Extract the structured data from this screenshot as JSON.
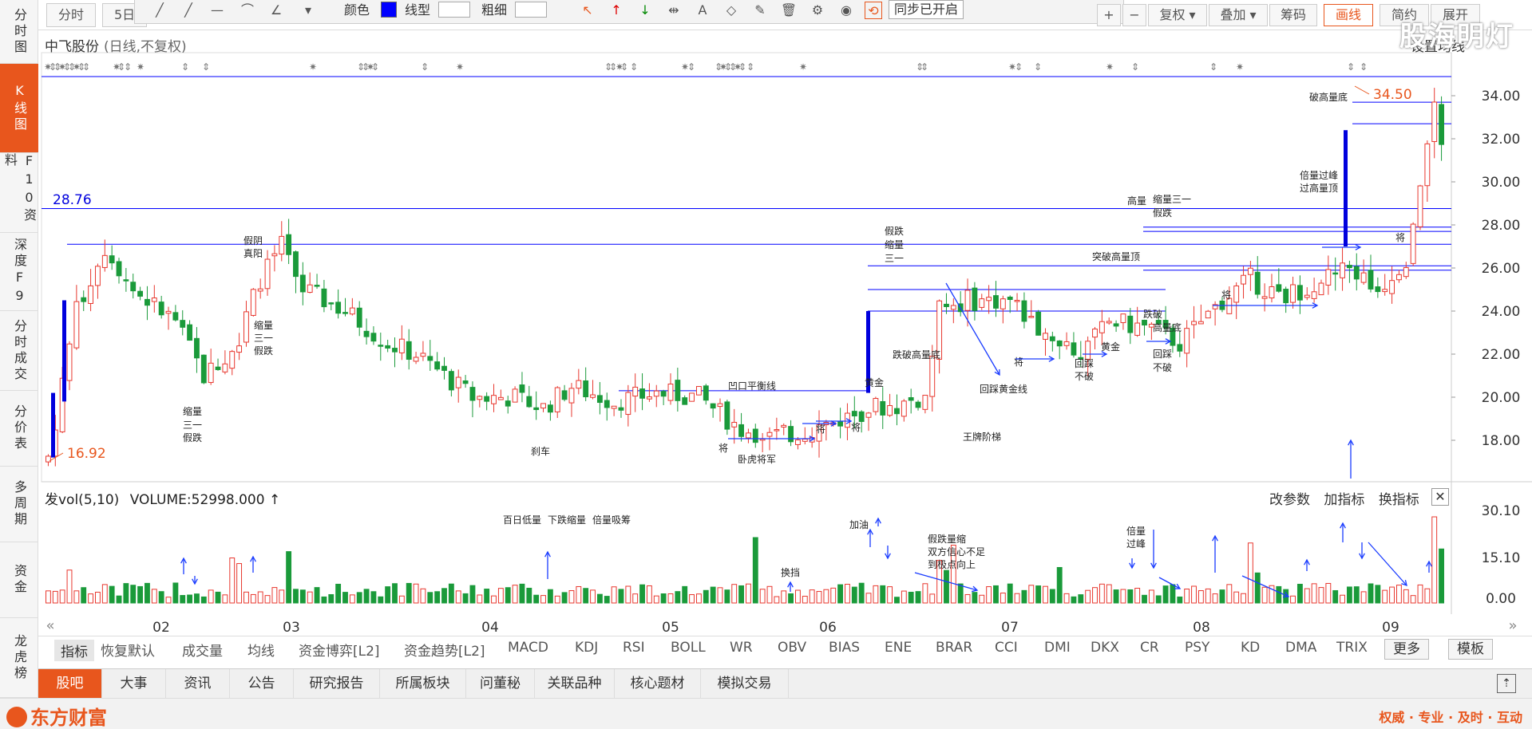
{
  "sidebar": {
    "items": [
      {
        "label": "分时图"
      },
      {
        "label": "K线图"
      },
      {
        "label": "F10资料"
      },
      {
        "label": "深度F9"
      },
      {
        "label": "分时成交"
      },
      {
        "label": "分价表"
      },
      {
        "label": "多周期"
      },
      {
        "label": "资金"
      },
      {
        "label": "龙虎榜"
      }
    ]
  },
  "toolbar": {
    "tabs": [
      "分时",
      "5日"
    ],
    "color_label": "颜色",
    "line_type_label": "线型",
    "thickness_label": "粗细",
    "sync_label": "同步已开启",
    "right_buttons": [
      {
        "label": "+"
      },
      {
        "label": "−"
      },
      {
        "label": "复权 ▾"
      },
      {
        "label": "叠加 ▾"
      },
      {
        "label": "筹码"
      },
      {
        "label": "画线"
      },
      {
        "label": "简约"
      },
      {
        "label": "展开"
      }
    ],
    "accent": "#e8561d",
    "line_color": "#0000ff"
  },
  "chart_header": {
    "stock_name": "中飞股份",
    "period_mode": "(日线,不复权)",
    "set_ma": "设置均线",
    "watermark": "股海明灯"
  },
  "price_axis": [
    "34.00",
    "32.00",
    "30.00",
    "28.00",
    "26.00",
    "24.00",
    "22.00",
    "20.00",
    "18.00"
  ],
  "price_marks": {
    "high": "34.50",
    "low": "16.92",
    "level": "28.76"
  },
  "volume_header": {
    "indicator": "发vol(5,10)",
    "value": "VOLUME:52998.000",
    "arrow": "↑",
    "controls": [
      "改参数",
      "加指标",
      "换指标"
    ],
    "close": "✕"
  },
  "volume_axis": [
    "30.10",
    "15.10",
    "0.00"
  ],
  "time_axis": [
    "02",
    "03",
    "04",
    "05",
    "06",
    "07",
    "08",
    "09"
  ],
  "annotations": {
    "fake_yin": "假阴",
    "real_yang": "真阳",
    "shrink_31_a": "缩量",
    "shrink_31_b": "三一",
    "shrink_31_c": "假跌",
    "concave": "凹口平衡线",
    "brake": "刹车",
    "tiger": "卧虎将军",
    "gold": "黄金",
    "fake_drop": "假跌",
    "fake_drop2": "缩量",
    "fake_drop3": "三一",
    "break_vol_bottom": "跌破高量底",
    "back_gold": "回踩黄金线",
    "king": "王牌阶梯",
    "gold2": "黄金",
    "back_not_break": "回踩",
    "back_not_break2": "不破",
    "break_high_top": "突破高量顶",
    "high_vol": "高量",
    "shrink31c": "缩量三一",
    "shrink31d": "假跌",
    "drop_break": "跌破",
    "drop_break2": "高量底",
    "back2": "回踩",
    "back2b": "不破",
    "double_peak": "倍量过峰",
    "pass_top": "过高量顶",
    "break_high": "破高量底",
    "jiang": "将",
    "vol_note1": "百日低量",
    "vol_note2": "下跌缩量",
    "vol_note3": "倍量吸筹",
    "vol_note4": "换挡",
    "vol_note5": "加油",
    "vol_note6": "假跌量缩",
    "vol_note7": "双方信心不足",
    "vol_note8": "到极点向上",
    "vol_note9": "倍量",
    "vol_note10": "过峰"
  },
  "indicator_bar": {
    "items": [
      "指标",
      "恢复默认",
      "成交量",
      "均线",
      "资金博弈[L2]",
      "资金趋势[L2]",
      "MACD",
      "KDJ",
      "RSI",
      "BOLL",
      "WR",
      "OBV",
      "BIAS",
      "ENE",
      "BRAR",
      "CCI",
      "DMI",
      "DKX",
      "CR",
      "PSY",
      "KD",
      "DMA",
      "TRIX"
    ],
    "more": "更多",
    "template": "模板"
  },
  "bottom_tabs": [
    "股吧",
    "大事",
    "资讯",
    "公告",
    "研究报告",
    "所属板块",
    "问董秘",
    "关联品种",
    "核心题材",
    "模拟交易"
  ],
  "footer": {
    "logo": "东方财富",
    "slogan": "权威 · 专业 · 及时 · 互动"
  },
  "colors": {
    "up": "#e8382f",
    "down": "#1a9a3a",
    "grid_line": "#0000ff",
    "accent": "#e8561d"
  }
}
